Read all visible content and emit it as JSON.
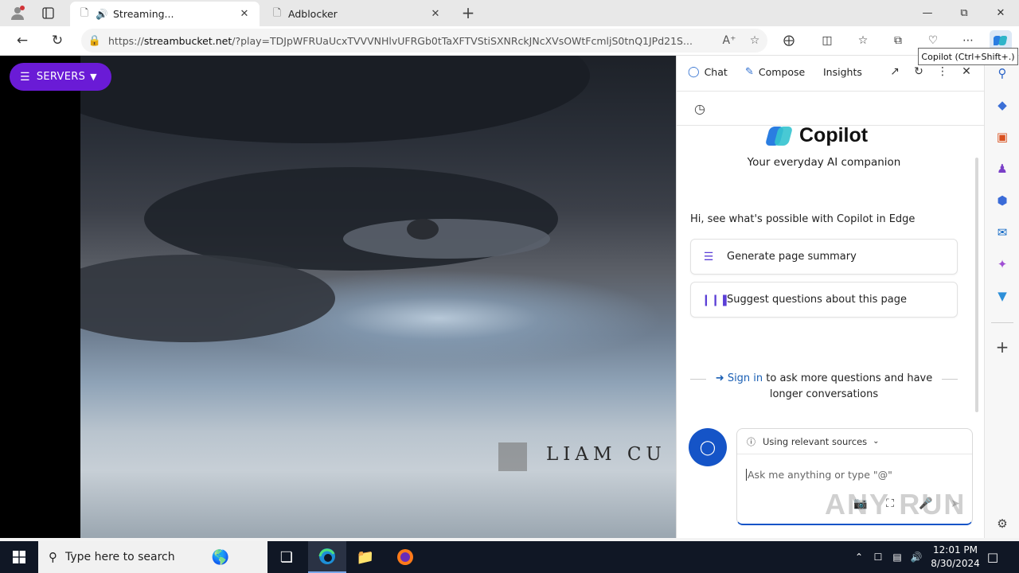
{
  "browser": {
    "tabs": [
      {
        "title": "Streaming...",
        "active": true
      },
      {
        "title": "Adblocker",
        "active": false
      }
    ],
    "address": {
      "url_prefix": "https://",
      "domain": "streambucket.net",
      "url_rest": "/?play=TDJpWFRUaUcxTVVVNHlvUFRGb0tTaXFTVStiSXNRckJNcXVsOWtFcmljS0tnQ1JPd21S..."
    },
    "tooltip": "Copilot (Ctrl+Shift+.)"
  },
  "page": {
    "servers_button": "SERVERS",
    "video_credit": "LIAM CU"
  },
  "copilot": {
    "tabs": {
      "chat": "Chat",
      "compose": "Compose",
      "insights": "Insights"
    },
    "brand": "Copilot",
    "tagline": "Your everyday AI companion",
    "intro": "Hi, see what's possible with Copilot in Edge",
    "suggestions": [
      {
        "label": "Generate page summary"
      },
      {
        "label": "Suggest questions about this page"
      }
    ],
    "signin": {
      "link": "Sign in",
      "rest": " to ask more questions and have",
      "line2": "longer conversations"
    },
    "sources_label": "Using relevant sources",
    "input_placeholder": "Ask me anything or type \"@\""
  },
  "taskbar": {
    "search_placeholder": "Type here to search",
    "time": "12:01 PM",
    "date": "8/30/2024"
  },
  "watermark": "ANY RUN",
  "colors": {
    "servers_button": "#6a1bd6",
    "copilot_blue": "#1554c7",
    "taskbar": "#101725"
  }
}
